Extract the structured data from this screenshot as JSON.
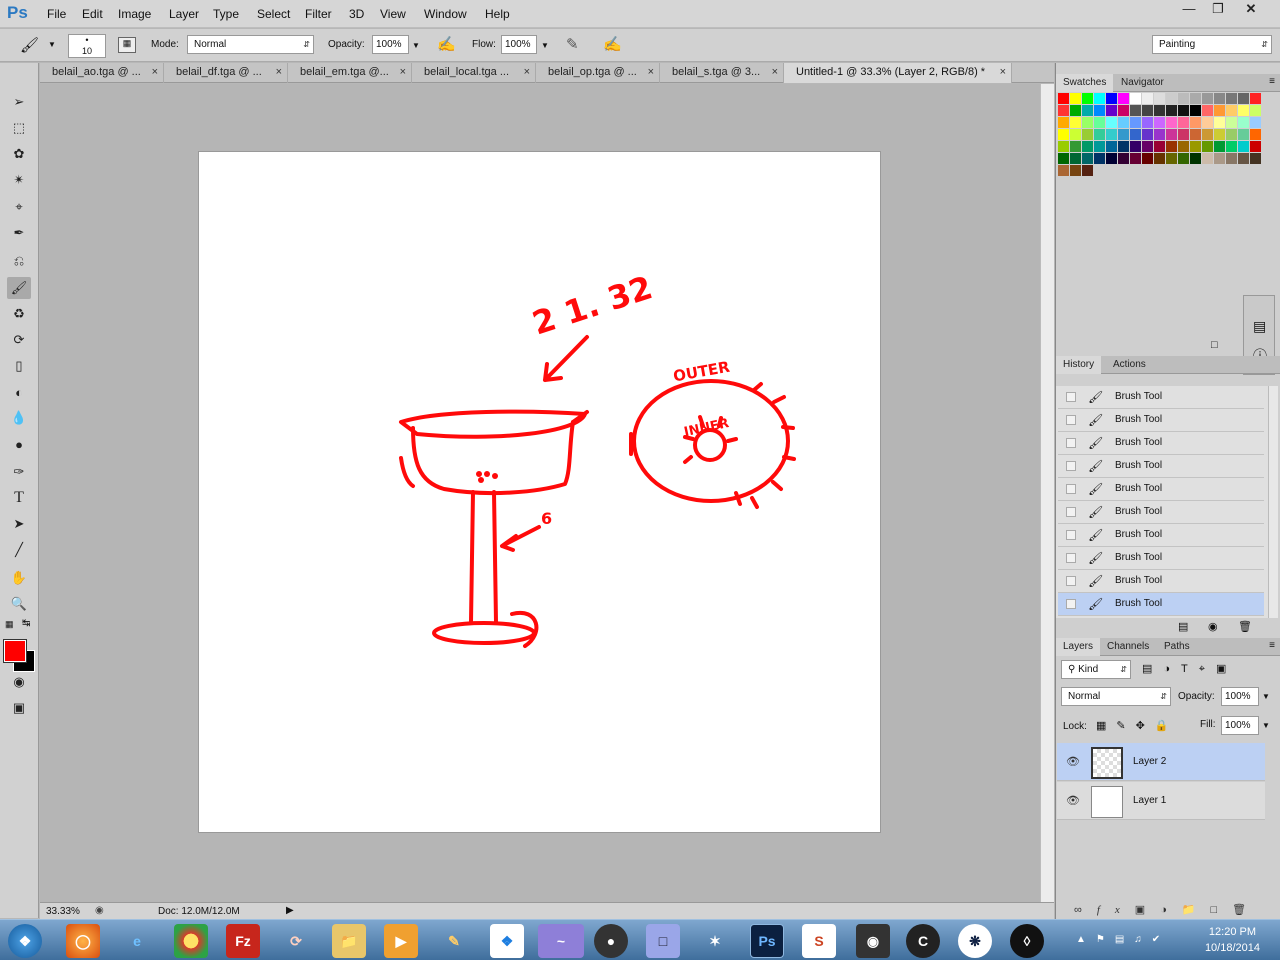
{
  "app": {
    "logo": "Ps"
  },
  "menu": [
    "File",
    "Edit",
    "Image",
    "Layer",
    "Type",
    "Select",
    "Filter",
    "3D",
    "View",
    "Window",
    "Help"
  ],
  "options": {
    "brush_size": "10",
    "mode_label": "Mode:",
    "mode_value": "Normal",
    "opacity_label": "Opacity:",
    "opacity_value": "100%",
    "flow_label": "Flow:",
    "flow_value": "100%",
    "workspace": "Painting"
  },
  "tabs": [
    {
      "label": "belail_ao.tga @ ..."
    },
    {
      "label": "belail_df.tga @ ..."
    },
    {
      "label": "belail_em.tga @..."
    },
    {
      "label": "belail_local.tga ..."
    },
    {
      "label": "belail_op.tga @ ..."
    },
    {
      "label": "belail_s.tga @ 3..."
    },
    {
      "label": "Untitled-1 @ 33.3% (Layer 2, RGB/8) *"
    }
  ],
  "canvas_annotations": {
    "number": "2 1. 32",
    "outer": "OUTER",
    "inner": "INNER",
    "six": "6"
  },
  "status": {
    "zoom": "33.33%",
    "doc": "Doc: 12.0M/12.0M"
  },
  "swatches_panel": {
    "tabs": [
      "Swatches",
      "Navigator"
    ]
  },
  "history_panel": {
    "tabs": [
      "History",
      "Actions"
    ],
    "items": [
      "Brush Tool",
      "Brush Tool",
      "Brush Tool",
      "Brush Tool",
      "Brush Tool",
      "Brush Tool",
      "Brush Tool",
      "Brush Tool",
      "Brush Tool",
      "Brush Tool"
    ]
  },
  "layers_panel": {
    "tabs": [
      "Layers",
      "Channels",
      "Paths"
    ],
    "kind": "Kind",
    "blend": "Normal",
    "opacity_label": "Opacity:",
    "opacity": "100%",
    "lock_label": "Lock:",
    "fill_label": "Fill:",
    "fill": "100%",
    "layers": [
      "Layer 2",
      "Layer 1"
    ]
  },
  "taskbar": {
    "time": "12:20 PM",
    "date": "10/18/2014"
  },
  "colors": {
    "foreground": "#ff0000",
    "background": "#000000",
    "sketch": "#ff0a0a"
  }
}
